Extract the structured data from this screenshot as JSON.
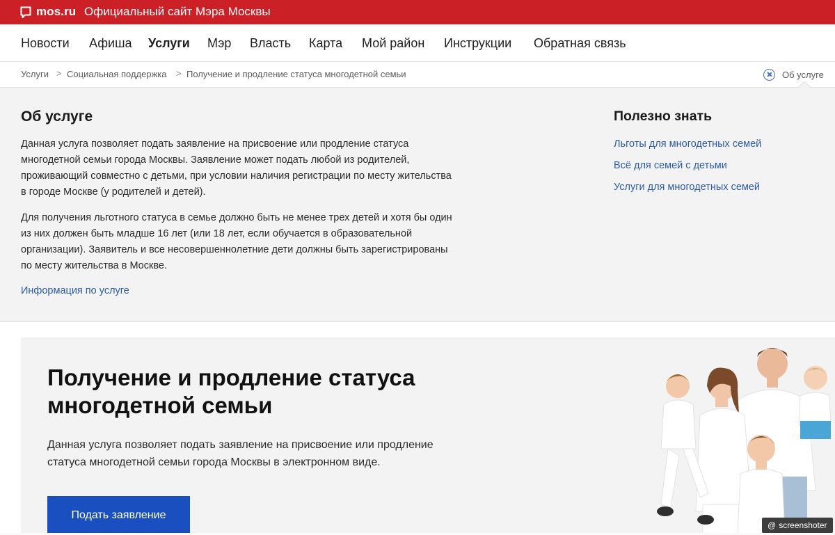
{
  "topbar": {
    "logo": "mos.ru",
    "site_title": "Официальный сайт Мэра Москвы",
    "brand_color": "#cc2027"
  },
  "nav": {
    "items": [
      "Новости",
      "Афиша",
      "Услуги",
      "Мэр",
      "Власть",
      "Карта",
      "Мой район",
      "Инструкции",
      "Обратная связь"
    ],
    "active": "Услуги"
  },
  "breadcrumbs": {
    "items": [
      "Услуги",
      "Социальная поддержка",
      "Получение и продление статуса многодетной семьи"
    ],
    "separator": ">",
    "about_toggle": "Об услуге"
  },
  "about": {
    "title": "Об услуге",
    "paragraph1": "Данная услуга позволяет подать заявление на присвоение или продление статуса многодетной семьи города Москвы. Заявление может подать любой из родителей, проживающий совместно с детьми, при условии наличия регистрации по месту жительства в городе Москве (у родителей и детей).",
    "paragraph2": "Для получения льготного статуса в семье должно быть не менее трех детей и хотя бы один из них должен быть младше 16 лет (или 18 лет, если обучается в образовательной организации). Заявитель и все несовершеннолетние дети должны быть зарегистрированы по месту жительства в Москве.",
    "info_link": "Информация по услуге",
    "useful_title": "Полезно знать",
    "useful_links": [
      "Льготы для многодетных семей",
      "Всё для семей с детьми",
      "Услуги для многодетных семей"
    ]
  },
  "hero": {
    "title": "Получение и продление статуса многодетной семьи",
    "description": "Данная услуга позволяет подать заявление на присвоение или продление статуса многодетной семьи города Москвы в электронном виде.",
    "apply_button": "Подать заявление",
    "button_color": "#1a4fbf"
  },
  "watermark": {
    "at": "@",
    "text": "screenshoter"
  }
}
